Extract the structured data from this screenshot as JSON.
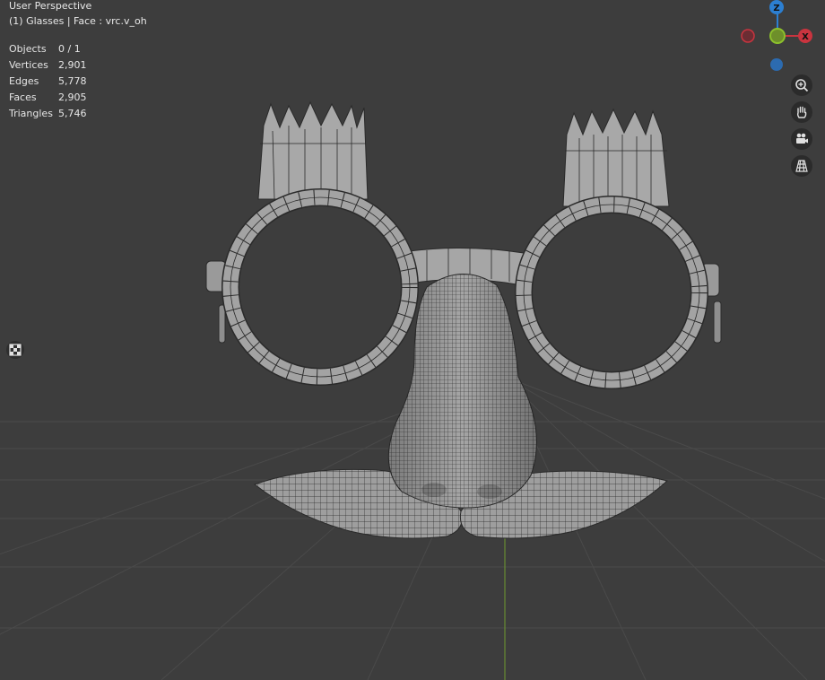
{
  "header": {
    "view_name": "User Perspective",
    "context": "(1) Glasses | Face : vrc.v_oh"
  },
  "stats": [
    {
      "label": "Objects",
      "value": "0 / 1"
    },
    {
      "label": "Vertices",
      "value": "2,901"
    },
    {
      "label": "Edges",
      "value": "5,778"
    },
    {
      "label": "Faces",
      "value": "2,905"
    },
    {
      "label": "Triangles",
      "value": "5,746"
    }
  ],
  "gizmo": {
    "z_label": "Z",
    "x_label": "X",
    "colors": {
      "x": "#c9343f",
      "y": "#7aa924",
      "z": "#2c7fd1"
    }
  },
  "nav_buttons": [
    "zoom-icon",
    "hand-pan-icon",
    "camera-icon",
    "grid-perspective-icon"
  ]
}
